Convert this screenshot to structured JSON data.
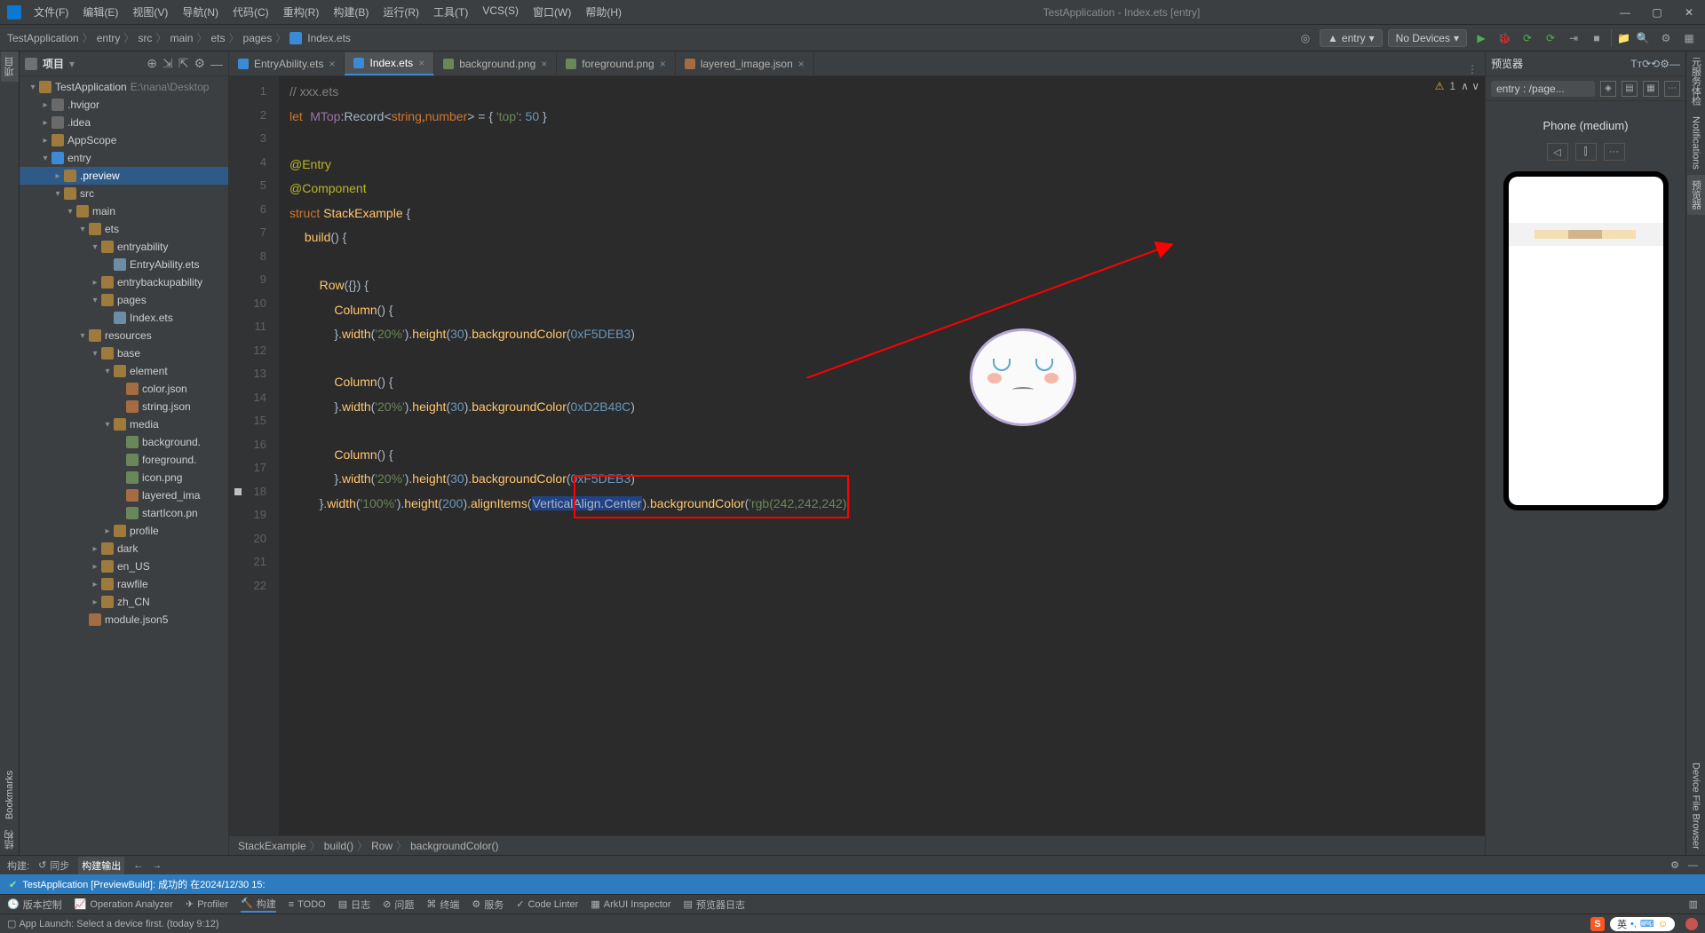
{
  "window_title": "TestApplication - Index.ets [entry]",
  "menus": [
    "文件(F)",
    "编辑(E)",
    "视图(V)",
    "导航(N)",
    "代码(C)",
    "重构(R)",
    "构建(B)",
    "运行(R)",
    "工具(T)",
    "VCS(S)",
    "窗口(W)",
    "帮助(H)"
  ],
  "breadcrumbs": [
    "TestApplication",
    "entry",
    "src",
    "main",
    "ets",
    "pages",
    "Index.ets"
  ],
  "run_config": "entry",
  "device_selector": "No Devices",
  "left_rail": [
    "项目",
    "Bookmarks",
    "结构"
  ],
  "right_rail": [
    "元服务体检",
    "Notifications",
    "预览器",
    "Device File Browser"
  ],
  "project_panel": {
    "title": "项目"
  },
  "tree": [
    {
      "depth": 0,
      "chev": "▾",
      "icon": "f-folder",
      "label": "TestApplication",
      "dim": "E:\\nana\\Desktop"
    },
    {
      "depth": 1,
      "chev": "▸",
      "icon": "f-folder-dark",
      "label": ".hvigor"
    },
    {
      "depth": 1,
      "chev": "▸",
      "icon": "f-folder-dark",
      "label": ".idea"
    },
    {
      "depth": 1,
      "chev": "▸",
      "icon": "f-folder",
      "label": "AppScope"
    },
    {
      "depth": 1,
      "chev": "▾",
      "icon": "f-mod",
      "label": "entry"
    },
    {
      "depth": 2,
      "chev": "▸",
      "icon": "f-folder",
      "label": ".preview",
      "sel": true
    },
    {
      "depth": 2,
      "chev": "▾",
      "icon": "f-folder",
      "label": "src"
    },
    {
      "depth": 3,
      "chev": "▾",
      "icon": "f-folder",
      "label": "main"
    },
    {
      "depth": 4,
      "chev": "▾",
      "icon": "f-folder",
      "label": "ets"
    },
    {
      "depth": 5,
      "chev": "▾",
      "icon": "f-folder",
      "label": "entryability"
    },
    {
      "depth": 6,
      "chev": "",
      "icon": "f-file",
      "label": "EntryAbility.ets"
    },
    {
      "depth": 5,
      "chev": "▸",
      "icon": "f-folder",
      "label": "entrybackupability"
    },
    {
      "depth": 5,
      "chev": "▾",
      "icon": "f-folder",
      "label": "pages"
    },
    {
      "depth": 6,
      "chev": "",
      "icon": "f-file",
      "label": "Index.ets"
    },
    {
      "depth": 4,
      "chev": "▾",
      "icon": "f-folder",
      "label": "resources"
    },
    {
      "depth": 5,
      "chev": "▾",
      "icon": "f-folder",
      "label": "base"
    },
    {
      "depth": 6,
      "chev": "▾",
      "icon": "f-folder",
      "label": "element"
    },
    {
      "depth": 7,
      "chev": "",
      "icon": "f-json",
      "label": "color.json"
    },
    {
      "depth": 7,
      "chev": "",
      "icon": "f-json",
      "label": "string.json"
    },
    {
      "depth": 6,
      "chev": "▾",
      "icon": "f-folder",
      "label": "media"
    },
    {
      "depth": 7,
      "chev": "",
      "icon": "f-img",
      "label": "background."
    },
    {
      "depth": 7,
      "chev": "",
      "icon": "f-img",
      "label": "foreground."
    },
    {
      "depth": 7,
      "chev": "",
      "icon": "f-img",
      "label": "icon.png"
    },
    {
      "depth": 7,
      "chev": "",
      "icon": "f-json",
      "label": "layered_ima"
    },
    {
      "depth": 7,
      "chev": "",
      "icon": "f-img",
      "label": "startIcon.pn"
    },
    {
      "depth": 6,
      "chev": "▸",
      "icon": "f-folder",
      "label": "profile"
    },
    {
      "depth": 5,
      "chev": "▸",
      "icon": "f-folder",
      "label": "dark"
    },
    {
      "depth": 5,
      "chev": "▸",
      "icon": "f-folder",
      "label": "en_US"
    },
    {
      "depth": 5,
      "chev": "▸",
      "icon": "f-folder",
      "label": "rawfile"
    },
    {
      "depth": 5,
      "chev": "▸",
      "icon": "f-folder",
      "label": "zh_CN"
    },
    {
      "depth": 4,
      "chev": "",
      "icon": "f-json",
      "label": "module.json5"
    }
  ],
  "tabs": [
    {
      "label": "EntryAbility.ets",
      "icon": "tico",
      "active": false
    },
    {
      "label": "Index.ets",
      "icon": "tico",
      "active": true
    },
    {
      "label": "background.png",
      "icon": "tico img",
      "active": false
    },
    {
      "label": "foreground.png",
      "icon": "tico img",
      "active": false
    },
    {
      "label": "layered_image.json",
      "icon": "tico json",
      "active": false
    }
  ],
  "code_status": {
    "warn": "⚠",
    "count": "1",
    "arrows": "∧ ∨"
  },
  "code_lines_numbers": [
    "1",
    "2",
    "3",
    "4",
    "5",
    "6",
    "7",
    "8",
    "9",
    "10",
    "11",
    "12",
    "13",
    "14",
    "15",
    "16",
    "17",
    "18",
    "19",
    "20",
    "21",
    "22"
  ],
  "code": {
    "l1_comment": "// xxx.ets",
    "l2_kw": "let",
    "l2_id": "MTop",
    "l2_ty": ":Record<",
    "l2_ty2": "string",
    "l2_ty3": ",",
    "l2_ty4": "number",
    "l2_ty5": "> = { ",
    "l2_str": "'top'",
    "l2_op": ": ",
    "l2_num": "50",
    "l2_end": " }",
    "l4": "@Entry",
    "l5": "@Component",
    "l6_kw": "struct",
    "l6_id": " StackExample ",
    "l6_b": "{",
    "l7_fn": "build",
    "l7_p": "() {",
    "l9_fn": "Row",
    "l9_p": "({}) {",
    "l10_fn": "Column",
    "l10_p": "() {",
    "l11_a": "}.",
    "l11_m1": "width",
    "l11_p1": "(",
    "l11_s1": "'20%'",
    "l11_p1e": ").",
    "l11_m2": "height",
    "l11_p2": "(",
    "l11_n2": "30",
    "l11_p2e": ").",
    "l11_m3": "backgroundColor",
    "l11_p3": "(",
    "l11_n3": "0xF5DEB3",
    "l11_p3e": ")",
    "l13_fn": "Column",
    "l13_p": "() {",
    "l14_a": "}.",
    "l14_m1": "width",
    "l14_p1": "(",
    "l14_s1": "'20%'",
    "l14_p1e": ").",
    "l14_m2": "height",
    "l14_p2": "(",
    "l14_n2": "30",
    "l14_p2e": ").",
    "l14_m3": "backgroundColor",
    "l14_p3": "(",
    "l14_n3": "0xD2B48C",
    "l14_p3e": ")",
    "l16_fn": "Column",
    "l16_p": "() {",
    "l17_a": "}.",
    "l17_m1": "width",
    "l17_p1": "(",
    "l17_s1": "'20%'",
    "l17_p1e": ").",
    "l17_m2": "height",
    "l17_p2": "(",
    "l17_n2": "30",
    "l17_p2e": ").",
    "l17_m3": "backgroundColor",
    "l17_p3": "(",
    "l17_n3": "0xF5DEB3",
    "l17_p3e": ")",
    "l18_a": "}.",
    "l18_m1": "width",
    "l18_p1": "(",
    "l18_s1": "'100%'",
    "l18_p1e": ").",
    "l18_m2": "height",
    "l18_p2": "(",
    "l18_n2": "200",
    "l18_p2e": ").",
    "l18_m3": "alignItems",
    "l18_p3": "(",
    "l18_v3": "VerticalAlign.Center",
    "l18_p3e": ").",
    "l18_m4": "backgroundColor",
    "l18_p4": "(",
    "l18_s4": "'rgb(242,242,242)"
  },
  "code_crumbs": [
    "StackExample",
    "build()",
    "Row",
    "backgroundColor()"
  ],
  "preview": {
    "title": "预览器",
    "path": "entry : /page...",
    "device": "Phone (medium)"
  },
  "tool_row1": {
    "build": "构建:",
    "sync": "同步",
    "output": "构建输出"
  },
  "build_msg": "TestApplication [PreviewBuild]: 成功的 在2024/12/30 15:",
  "bottom_items": [
    "版本控制",
    "Operation Analyzer",
    "Profiler",
    "构建",
    "TODO",
    "日志",
    "问题",
    "终端",
    "服务",
    "Code Linter",
    "ArkUI Inspector",
    "预览器日志"
  ],
  "status_msg": "App Launch: Select a device first. (today 9:12)",
  "ime": {
    "s": "S",
    "lang": "英"
  }
}
